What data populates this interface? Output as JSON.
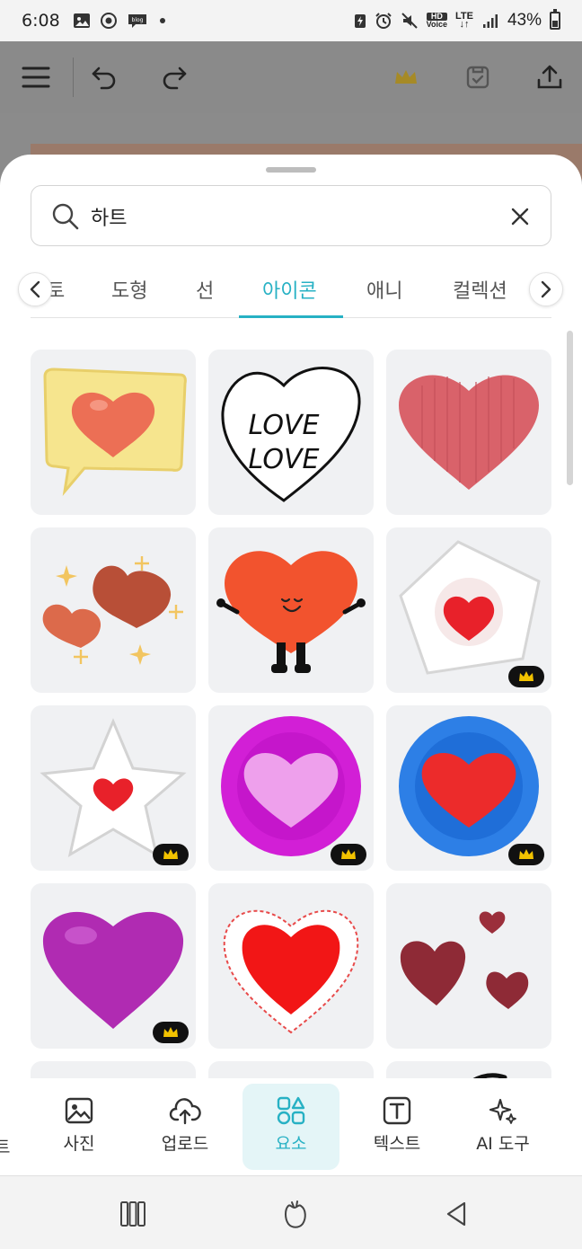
{
  "status_bar": {
    "time": "6:08",
    "battery": "43%",
    "network": "LTE",
    "hd_label": "HD",
    "voice_label": "Voice",
    "left_icons": [
      "gallery-icon",
      "target-icon",
      "blog-icon",
      "dot-icon"
    ],
    "right_icons": [
      "power-icon",
      "alarm-icon",
      "mute-icon",
      "hd-voice-icon",
      "lte-icon",
      "signal-icon",
      "battery-icon"
    ]
  },
  "editor_toolbar": {
    "icons": [
      "menu-icon",
      "undo-icon",
      "redo-icon",
      "crown-icon",
      "save-icon",
      "share-icon"
    ],
    "crown_color": "#c9a227"
  },
  "search": {
    "value": "하트",
    "placeholder": ""
  },
  "tabs": {
    "items": [
      {
        "label": "토",
        "active": false
      },
      {
        "label": "도형",
        "active": false
      },
      {
        "label": "선",
        "active": false
      },
      {
        "label": "아이콘",
        "active": true
      },
      {
        "label": "애니",
        "active": false
      },
      {
        "label": "컬렉션",
        "active": false
      }
    ],
    "accent": "#27b1c4"
  },
  "results": {
    "tiles": [
      {
        "art": "speech-bubble-heart",
        "premium": false
      },
      {
        "art": "love-love-heart",
        "premium": false,
        "text_lines": [
          "LOVE",
          "LOVE"
        ]
      },
      {
        "art": "textured-red-heart",
        "premium": false
      },
      {
        "art": "sparkle-hearts",
        "premium": false
      },
      {
        "art": "smiling-heart-character",
        "premium": false
      },
      {
        "art": "pentagon-heart",
        "premium": true
      },
      {
        "art": "star-heart",
        "premium": true
      },
      {
        "art": "magenta-circle-heart",
        "premium": true
      },
      {
        "art": "blue-circle-heart",
        "premium": true
      },
      {
        "art": "purple-3d-heart",
        "premium": true
      },
      {
        "art": "lace-red-heart",
        "premium": false
      },
      {
        "art": "painted-red-hearts",
        "premium": false
      }
    ],
    "premium_icon": "crown-icon",
    "premium_color": "#f2c200"
  },
  "bottom_nav": {
    "partial_label": "트",
    "items": [
      {
        "label": "사진",
        "icon": "photo-icon",
        "active": false
      },
      {
        "label": "업로드",
        "icon": "cloud-upload-icon",
        "active": false
      },
      {
        "label": "요소",
        "icon": "elements-icon",
        "active": true
      },
      {
        "label": "텍스트",
        "icon": "text-icon",
        "active": false
      },
      {
        "label": "AI 도구",
        "icon": "sparkle-icon",
        "active": false
      }
    ]
  },
  "system_nav": {
    "icons": [
      "recents-icon",
      "home-icon",
      "back-icon"
    ]
  }
}
